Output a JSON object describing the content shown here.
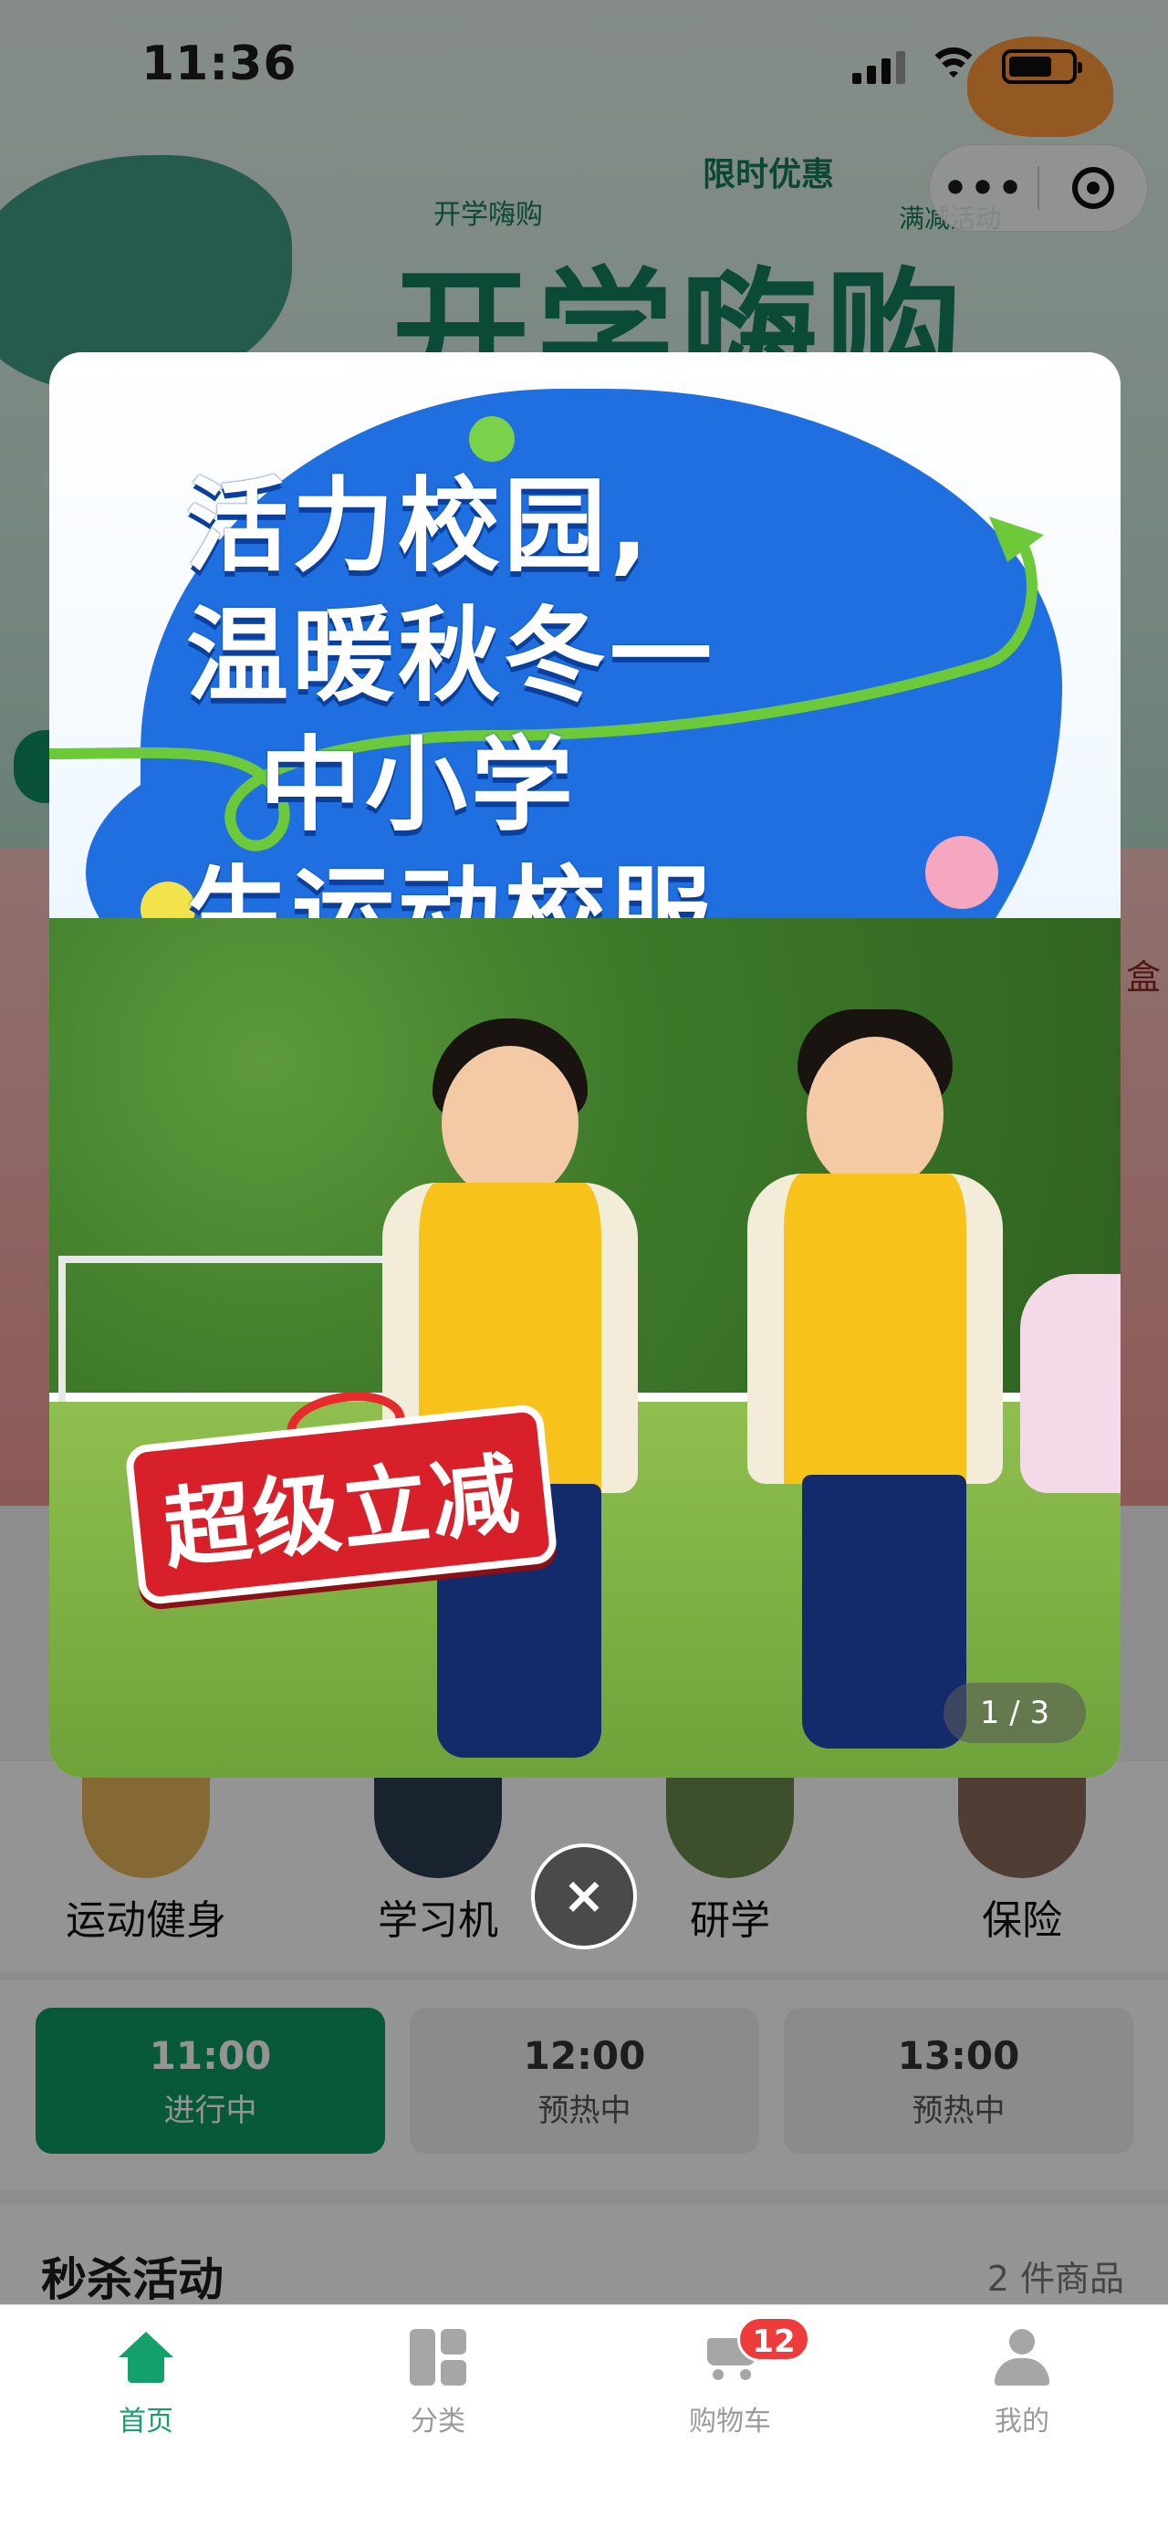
{
  "status_bar": {
    "time": "11:36"
  },
  "banner": {
    "title": "开学嗨购",
    "badge_left": "开学嗨购",
    "badge_center": "限时优惠",
    "badge_right": "满减活动"
  },
  "promo": {
    "side_tag": "盒"
  },
  "categories": [
    {
      "label": "运动健身"
    },
    {
      "label": "学习机"
    },
    {
      "label": "研学"
    },
    {
      "label": "保险"
    }
  ],
  "time_slots": [
    {
      "time": "11:00",
      "status": "进行中",
      "active": true
    },
    {
      "time": "12:00",
      "status": "预热中",
      "active": false
    },
    {
      "time": "13:00",
      "status": "预热中",
      "active": false
    }
  ],
  "section": {
    "title": "秒杀活动",
    "count": "2 件商品"
  },
  "popup": {
    "headline": [
      "活力校园,",
      "温暖秋冬一",
      "中小学",
      "生运动校服"
    ],
    "sale_text": "超级立减",
    "page_indicator": "1 / 3",
    "close_symbol": "×"
  },
  "tabbar": {
    "items": [
      {
        "label": "首页",
        "icon": "home-icon",
        "active": true
      },
      {
        "label": "分类",
        "icon": "category-icon",
        "active": false
      },
      {
        "label": "购物车",
        "icon": "cart-icon",
        "active": false,
        "badge": "12"
      },
      {
        "label": "我的",
        "icon": "profile-icon",
        "active": false
      }
    ]
  },
  "colors": {
    "primary_green": "#13a06b",
    "badge_red": "#ee3b3b",
    "headline_blue": "#1f6fe0"
  }
}
